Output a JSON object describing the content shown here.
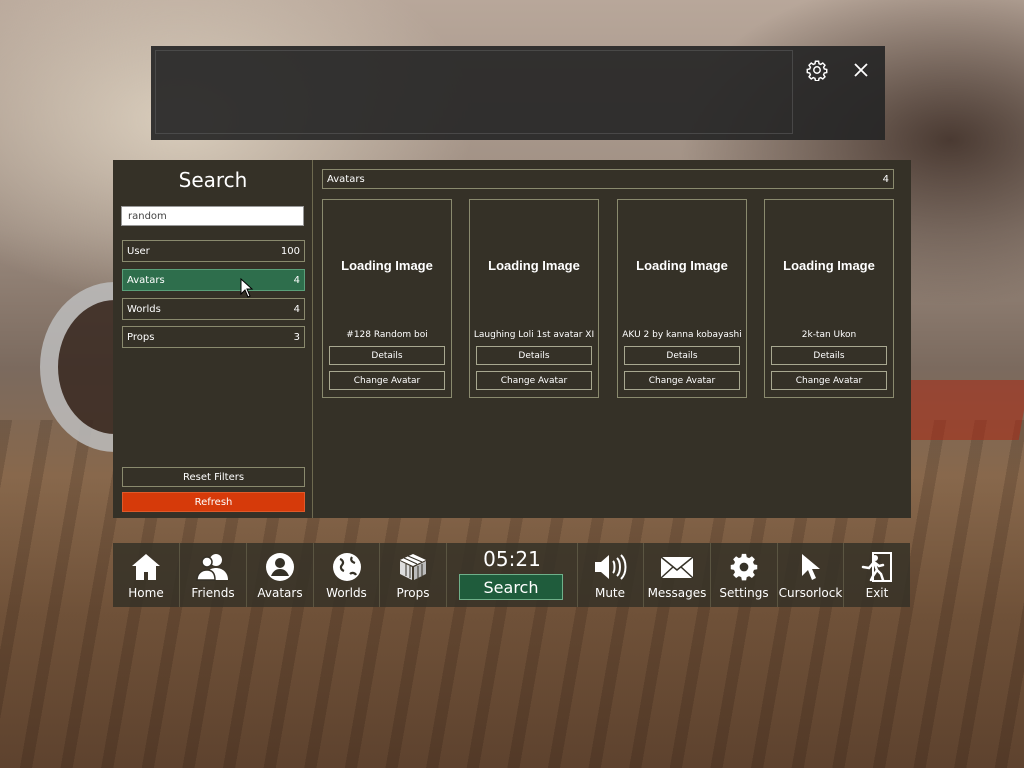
{
  "search_panel": {
    "title": "Search",
    "query_value": "random",
    "categories": [
      {
        "label": "User",
        "count": "100",
        "active": false
      },
      {
        "label": "Avatars",
        "count": "4",
        "active": true
      },
      {
        "label": "Worlds",
        "count": "4",
        "active": false
      },
      {
        "label": "Props",
        "count": "3",
        "active": false
      }
    ],
    "reset_label": "Reset Filters",
    "refresh_label": "Refresh",
    "refresh_color": "#d63a0a",
    "active_color": "#2e6e4c"
  },
  "results": {
    "header_label": "Avatars",
    "header_count": "4",
    "cards": [
      {
        "loading": "Loading Image",
        "name": "#128 Random boi",
        "details": "Details",
        "change": "Change Avatar"
      },
      {
        "loading": "Loading Image",
        "name": "Laughing Loli 1st avatar XI",
        "details": "Details",
        "change": "Change Avatar"
      },
      {
        "loading": "Loading Image",
        "name": "AKU 2 by kanna kobayashi",
        "details": "Details",
        "change": "Change Avatar"
      },
      {
        "loading": "Loading Image",
        "name": "2k-tan Ukon",
        "details": "Details",
        "change": "Change Avatar"
      }
    ]
  },
  "topbar": {
    "icons": [
      "gear-icon",
      "close-icon"
    ]
  },
  "toolbar": {
    "clock": "05:21",
    "search_label": "Search",
    "items": [
      {
        "label": "Home",
        "icon": "home-icon"
      },
      {
        "label": "Friends",
        "icon": "friends-icon"
      },
      {
        "label": "Avatars",
        "icon": "avatar-icon"
      },
      {
        "label": "Worlds",
        "icon": "globe-icon"
      },
      {
        "label": "Props",
        "icon": "cube-icon"
      },
      {
        "label": "Mute",
        "icon": "speaker-icon"
      },
      {
        "label": "Messages",
        "icon": "envelope-icon"
      },
      {
        "label": "Settings",
        "icon": "gear-icon"
      },
      {
        "label": "Cursorlock",
        "icon": "cursor-icon"
      },
      {
        "label": "Exit",
        "icon": "exit-icon"
      }
    ]
  }
}
